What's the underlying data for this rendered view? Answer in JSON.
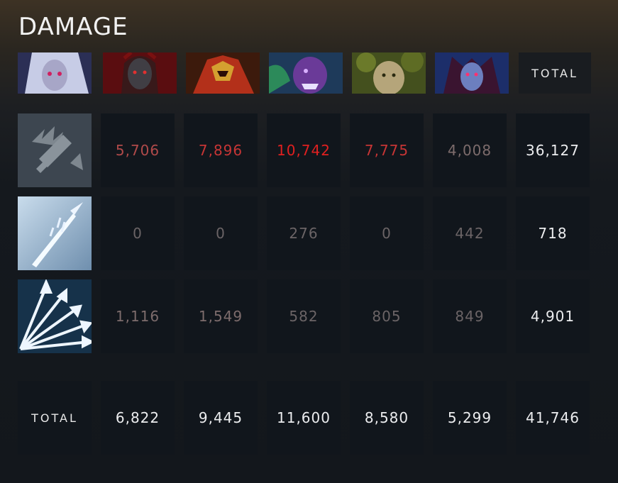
{
  "title": "DAMAGE",
  "total_label": "TOTAL",
  "heroes": [
    {
      "name": "drow-ranger-portrait"
    },
    {
      "name": "queen-of-pain-portrait"
    },
    {
      "name": "dragon-knight-portrait"
    },
    {
      "name": "faceless-void-portrait"
    },
    {
      "name": "treant-portrait"
    },
    {
      "name": "vengeful-spirit-portrait"
    }
  ],
  "rows": [
    {
      "icon": "attack-damage-icon",
      "values": [
        "5,706",
        "7,896",
        "10,742",
        "7,775",
        "4,008"
      ],
      "total": "36,127"
    },
    {
      "icon": "frost-arrow-icon",
      "values": [
        "0",
        "0",
        "276",
        "0",
        "442"
      ],
      "total": "718"
    },
    {
      "icon": "multishot-icon",
      "values": [
        "1,116",
        "1,549",
        "582",
        "805",
        "849"
      ],
      "total": "4,901"
    }
  ],
  "totals_row": {
    "values": [
      "6,822",
      "9,445",
      "11,600",
      "8,580",
      "5,299"
    ],
    "total": "41,746"
  },
  "colors": {
    "cell_bg": "#11161c",
    "damage_red": "#e02020"
  }
}
